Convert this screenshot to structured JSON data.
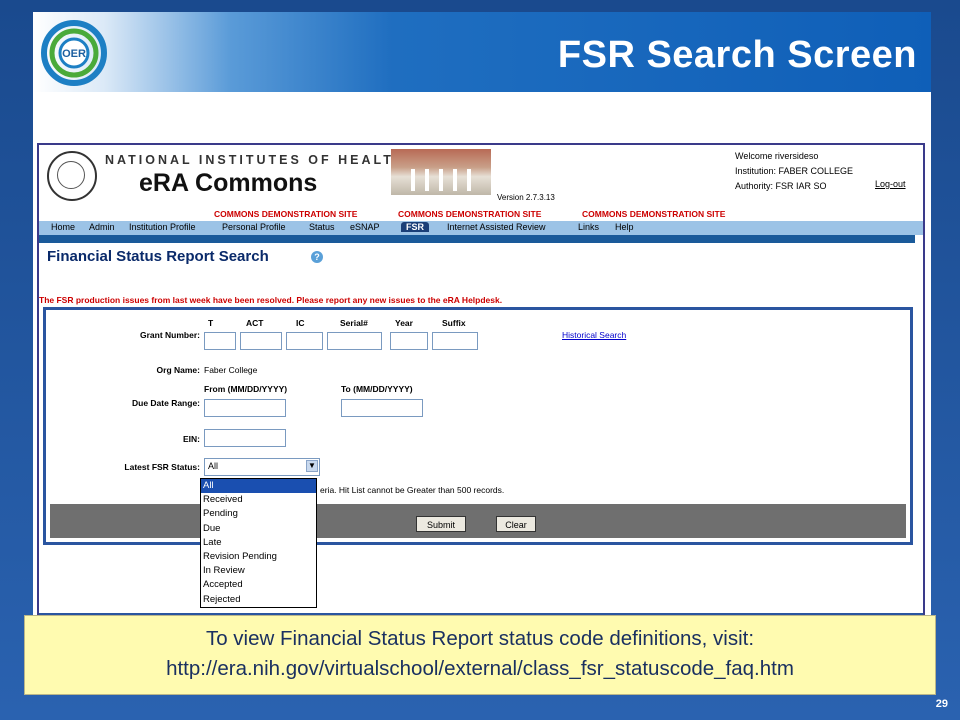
{
  "slide": {
    "title": "FSR Search Screen",
    "logo_text": "OER",
    "page_number": "29"
  },
  "era": {
    "nih_name": "NATIONAL INSTITUTES OF HEALTH",
    "app_name": "eRA Commons",
    "version": "Version 2.7.3.13",
    "welcome": "Welcome riversideso",
    "institution": "Institution: FABER COLLEGE",
    "authority": "Authority:  FSR  IAR  SO",
    "logout": "Log-out",
    "demo_banner": "COMMONS DEMONSTRATION SITE",
    "tabs": [
      "Home",
      "Admin",
      "Institution Profile",
      "Personal Profile",
      "Status",
      "eSNAP",
      "FSR",
      "Internet Assisted Review",
      "Links",
      "Help"
    ],
    "active_tab": "FSR"
  },
  "page": {
    "heading": "Financial Status Report Search",
    "help_icon": "?",
    "notice": "The FSR production issues from last week have been resolved.  Please report any new issues to the eRA Helpdesk."
  },
  "form": {
    "grant_number_label": "Grant Number:",
    "grant_cols": [
      "T",
      "ACT",
      "IC",
      "Serial#",
      "Year",
      "Suffix"
    ],
    "historical_search": "Historical Search",
    "org_name_label": "Org Name:",
    "org_name_value": "Faber College",
    "due_date_label": "Due Date Range:",
    "from_label": "From (MM/DD/YYYY)",
    "to_label": "To (MM/DD/YYYY)",
    "ein_label": "EIN:",
    "status_label": "Latest FSR Status:",
    "status_value": "All",
    "status_options": [
      "All",
      "Received",
      "Pending",
      "Due",
      "Late",
      "Revision Pending",
      "In Review",
      "Accepted",
      "Rejected"
    ],
    "hint": "eria. Hit List cannot be Greater than 500 records.",
    "submit": "Submit",
    "clear": "Clear"
  },
  "callout": {
    "line1": "To view Financial Status Report status code definitions, visit:",
    "line2": "http://era.nih.gov/virtualschool/external/class_fsr_statuscode_faq.htm"
  }
}
